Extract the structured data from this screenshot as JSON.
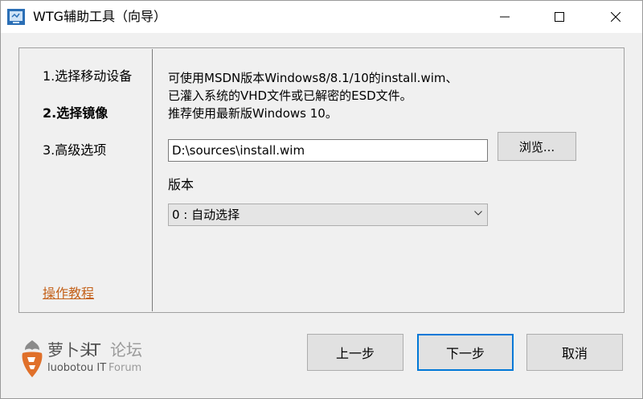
{
  "window": {
    "title": "WTG辅助工具（向导）",
    "icons": {
      "app": "wtg-app-icon",
      "minimize": "minimize-icon",
      "maximize": "maximize-icon",
      "close": "close-icon"
    }
  },
  "steps": {
    "items": [
      {
        "label": "1.选择移动设备",
        "active": false
      },
      {
        "label": "2.选择镜像",
        "active": true
      },
      {
        "label": "3.高级选项",
        "active": false
      }
    ],
    "tutorial_link": "操作教程"
  },
  "main": {
    "description": [
      "可使用MSDN版本Windows8/8.1/10的install.wim、",
      "已灌入系统的VHD文件或已解密的ESD文件。",
      "推荐使用最新版Windows 10。"
    ],
    "image_path": {
      "value": "D:\\sources\\install.wim",
      "placeholder": ""
    },
    "browse_label": "浏览...",
    "version_label": "版本",
    "version_selected": "0 : 自动选择"
  },
  "footer": {
    "logo": {
      "cn_primary": "萝卜头",
      "cn_it": "IT",
      "cn_secondary": "论坛",
      "en_primary": "luobotou IT",
      "en_secondary": "Forum",
      "icon": "radish-logo-icon"
    },
    "prev_label": "上一步",
    "next_label": "下一步",
    "cancel_label": "取消"
  },
  "colors": {
    "link": "#c4621b",
    "focus_border": "#0078d7",
    "logo_orange": "#e0702a",
    "logo_green": "#8a8a8a"
  }
}
